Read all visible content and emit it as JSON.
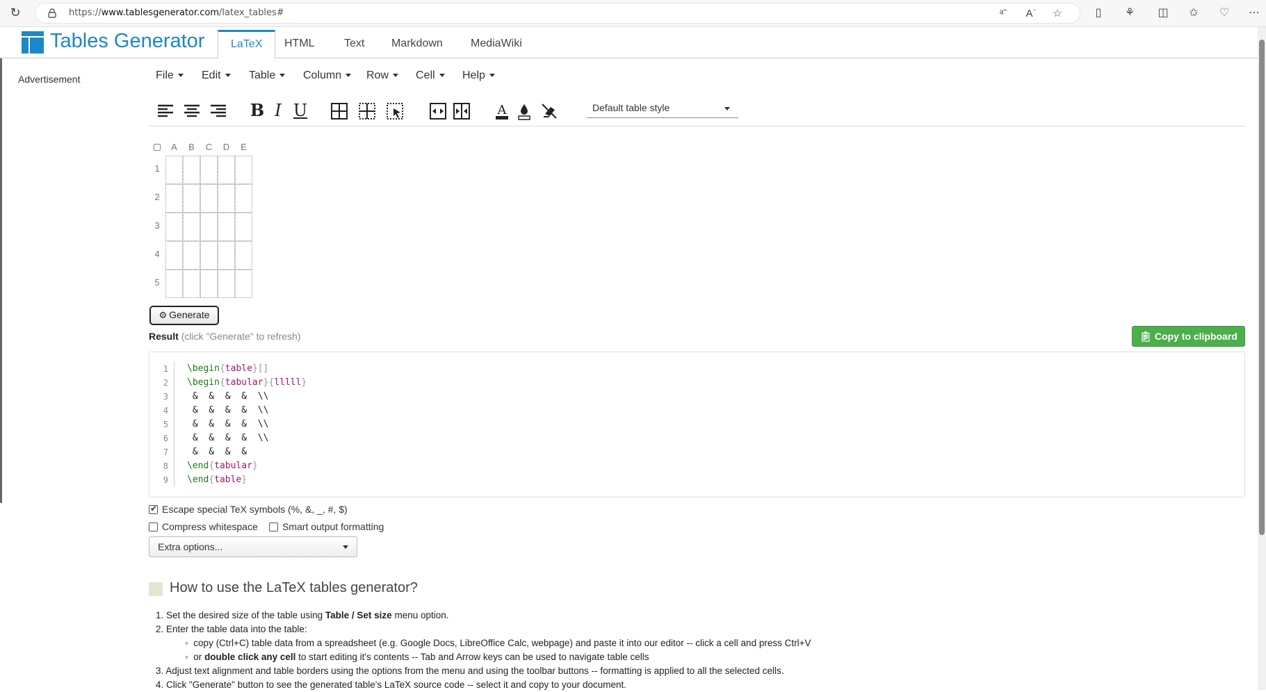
{
  "browser": {
    "url_prefix": "https://",
    "url_domain": "www.tablesgenerator.com",
    "url_path": "/latex_tables#"
  },
  "site": {
    "logo_text": "Tables Generator",
    "tabs": [
      {
        "label": "LaTeX",
        "active": true
      },
      {
        "label": "HTML",
        "active": false
      },
      {
        "label": "Text",
        "active": false
      },
      {
        "label": "Markdown",
        "active": false
      },
      {
        "label": "MediaWiki",
        "active": false
      }
    ],
    "advertisement": "Advertisement"
  },
  "menu": [
    "File",
    "Edit",
    "Table",
    "Column",
    "Row",
    "Cell",
    "Help"
  ],
  "toolbar": {
    "table_style": "Default table style"
  },
  "grid": {
    "columns": [
      "A",
      "B",
      "C",
      "D",
      "E"
    ],
    "rows": [
      "1",
      "2",
      "3",
      "4",
      "5"
    ]
  },
  "generate_label": "Generate",
  "result": {
    "label": "Result",
    "hint": "(click \"Generate\" to refresh)",
    "copy_label": "Copy to clipboard"
  },
  "code": {
    "line_numbers": [
      "1",
      "2",
      "3",
      "4",
      "5",
      "6",
      "7",
      "8",
      "9"
    ],
    "begin": "\\begin",
    "end": "\\end",
    "table": "table",
    "tabular": "tabular",
    "colspec": "lllll",
    "row_text": " &  &  &  &  \\\\",
    "last_row_text": " &  &  &  & "
  },
  "options": {
    "escape": {
      "label": "Escape special TeX symbols (%, &, _, #, $)",
      "checked": true
    },
    "compress": {
      "label": "Compress whitespace",
      "checked": false
    },
    "smart": {
      "label": "Smart output formatting",
      "checked": false
    },
    "extra": "Extra options..."
  },
  "howto": {
    "title": "How to use the LaTeX tables generator?",
    "s1_pre": "1. Set the desired size of the table using ",
    "s1_bold": "Table / Set size",
    "s1_post": " menu option.",
    "s2": "2. Enter the table data into the table:",
    "s2a": "copy (Ctrl+C) table data from a spreadsheet (e.g. Google Docs, LibreOffice Calc, webpage) and paste it into our editor -- click a cell and press Ctrl+V",
    "s2b_pre": "or ",
    "s2b_bold": "double click any cell",
    "s2b_post": " to start editing it's contents -- Tab and Arrow keys can be used to navigate table cells",
    "s3": "3. Adjust text alignment and table borders using the options from the menu and using the toolbar buttons -- formatting is applied to all the selected cells.",
    "s4": "4. Click \"Generate\" button to see the generated table's LaTeX source code -- select it and copy to your document."
  },
  "colors": {
    "brand": "#1c87c9",
    "copy_button": "#4cae4c",
    "keyword": "#1a7a1a",
    "argument": "#a3156e"
  }
}
